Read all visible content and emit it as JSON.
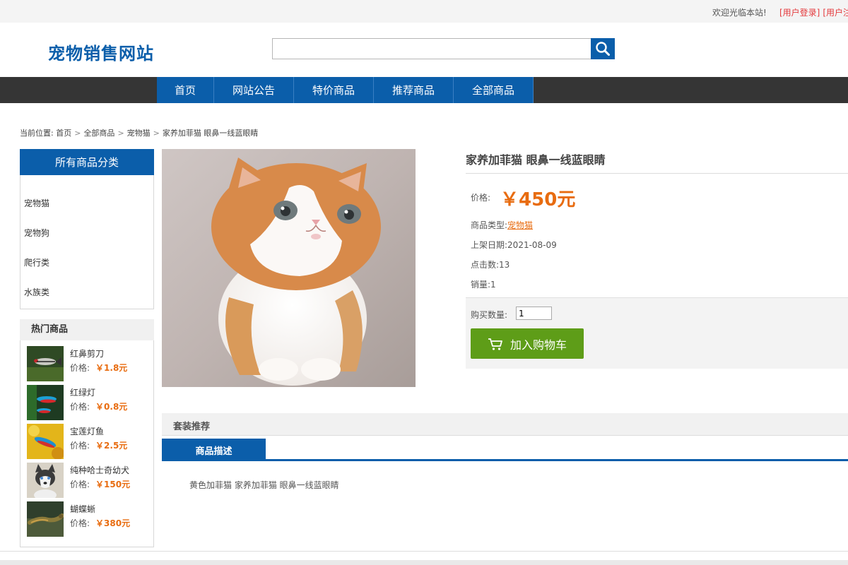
{
  "topbar": {
    "welcome": "欢迎光临本站!",
    "login_link": "[用户登录]",
    "register_link": "[用户注"
  },
  "header": {
    "logo": "宠物销售网站",
    "search_value": "",
    "search_icon": "search-icon"
  },
  "nav": {
    "items": [
      "首页",
      "网站公告",
      "特价商品",
      "推荐商品",
      "全部商品"
    ]
  },
  "breadcrumb": {
    "prefix": "当前位置:",
    "items": [
      "首页",
      "全部商品",
      "宠物猫",
      "家养加菲猫 眼鼻一线蓝眼睛"
    ]
  },
  "categories": {
    "title": "所有商品分类",
    "items": [
      "宠物猫",
      "宠物狗",
      "爬行类",
      "水族类"
    ]
  },
  "hot": {
    "title": "热门商品",
    "price_label": "价格:",
    "items": [
      {
        "name": "红鼻剪刀",
        "price": "￥1.8元"
      },
      {
        "name": "红绿灯",
        "price": "￥0.8元"
      },
      {
        "name": "宝莲灯鱼",
        "price": "￥2.5元"
      },
      {
        "name": "纯种哈士奇幼犬",
        "price": "￥150元"
      },
      {
        "name": "蝴蝶蜥",
        "price": "￥380元"
      }
    ]
  },
  "product": {
    "title": "家养加菲猫 眼鼻一线蓝眼睛",
    "price_label": "价格:",
    "price": "￥450元",
    "type_label": "商品类型:",
    "type_value": "宠物猫",
    "date_label": "上架日期:",
    "date_value": "2021-08-09",
    "clicks_label": "点击数:",
    "clicks_value": "13",
    "sales_label": "销量:",
    "sales_value": "1",
    "qty_label": "购买数量:",
    "qty_value": "1",
    "cart_button": "加入购物车"
  },
  "tabs": {
    "set_title": "套装推荐",
    "desc_tab": "商品描述",
    "desc_text": "黄色加菲猫 家养加菲猫 眼鼻一线蓝眼睛"
  },
  "colors": {
    "brand_blue": "#0b5eaa",
    "nav_dark": "#353535",
    "price_orange": "#e86c10",
    "cart_green": "#5e9d18",
    "link_red": "#e4393c"
  }
}
